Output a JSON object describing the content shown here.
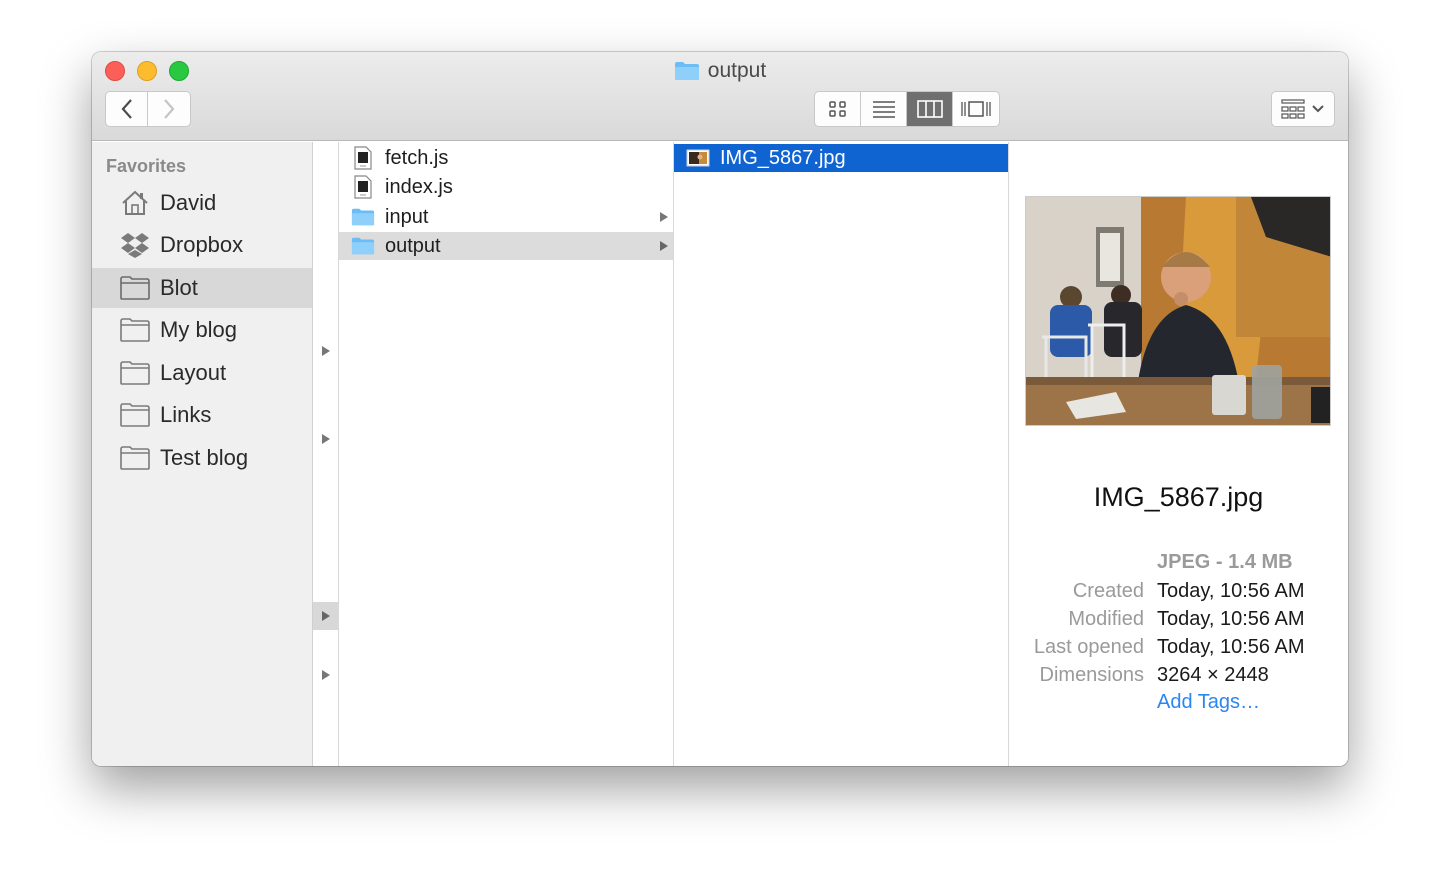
{
  "window": {
    "title": "output"
  },
  "toolbar": {
    "view_modes": [
      "icon-view",
      "list-view",
      "column-view",
      "cover-flow-view"
    ],
    "active_view": "column-view"
  },
  "sidebar": {
    "header": "Favorites",
    "items": [
      {
        "label": "David",
        "icon": "home-icon"
      },
      {
        "label": "Dropbox",
        "icon": "dropbox-icon"
      },
      {
        "label": "Blot",
        "icon": "folder-icon",
        "selected": true
      },
      {
        "label": "My blog",
        "icon": "folder-icon"
      },
      {
        "label": "Layout",
        "icon": "folder-icon"
      },
      {
        "label": "Links",
        "icon": "folder-icon"
      },
      {
        "label": "Test blog",
        "icon": "folder-icon"
      }
    ]
  },
  "column1": {
    "items": [
      {
        "label": "fetch.js",
        "kind": "file"
      },
      {
        "label": "index.js",
        "kind": "file"
      },
      {
        "label": "input",
        "kind": "folder"
      },
      {
        "label": "output",
        "kind": "folder",
        "selected": true
      }
    ]
  },
  "column2": {
    "items": [
      {
        "label": "IMG_5867.jpg",
        "kind": "image",
        "selected": true
      }
    ]
  },
  "preview": {
    "name": "IMG_5867.jpg",
    "kind": "JPEG - 1.4 MB",
    "created_label": "Created",
    "created_value": "Today, 10:56 AM",
    "modified_label": "Modified",
    "modified_value": "Today, 10:56 AM",
    "opened_label": "Last opened",
    "opened_value": "Today, 10:56 AM",
    "dimensions_label": "Dimensions",
    "dimensions_value": "3264 × 2448",
    "add_tags": "Add Tags…"
  },
  "colors": {
    "selection_blue": "#0f64d2",
    "folder_blue": "#6cbdf5",
    "link_blue": "#2a86f0"
  }
}
